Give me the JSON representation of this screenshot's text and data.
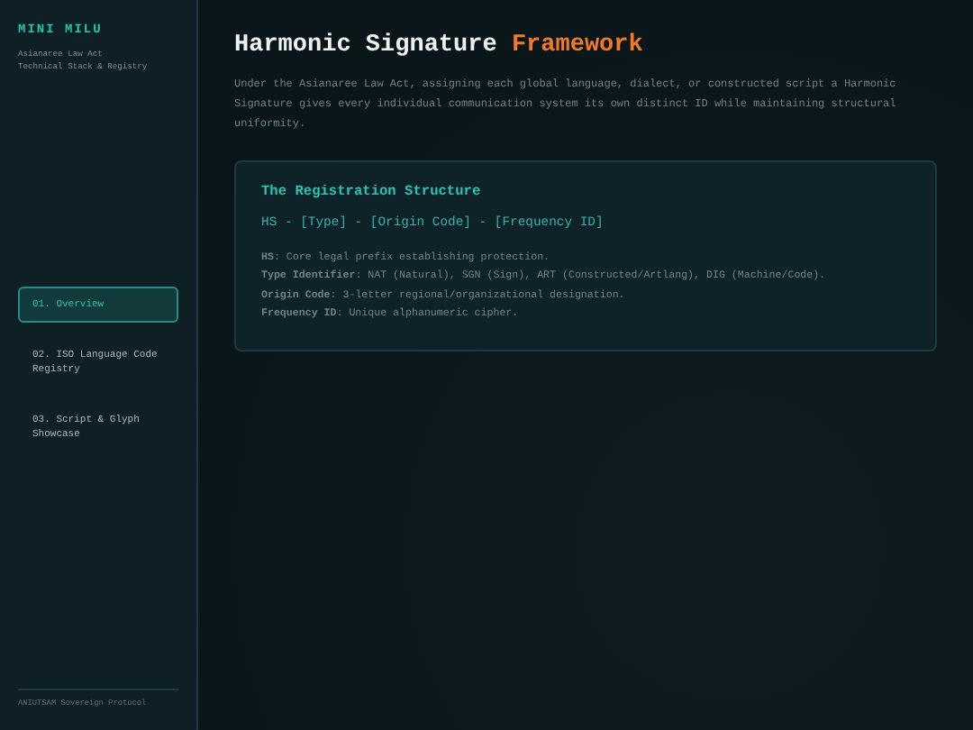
{
  "sidebar": {
    "brand": "MINI MILU",
    "subtitle_lines": [
      "Asianaree Law Act",
      "Technical Stack & Registry"
    ],
    "items": [
      {
        "label": "01. Overview",
        "selected": true
      },
      {
        "label": "02. ISO Language Code Registry",
        "selected": false
      },
      {
        "label": "03. Script & Glyph Showcase",
        "selected": false
      }
    ],
    "footer": "ANIUTSAM Sovereign Protocol"
  },
  "main": {
    "title": "Harmonic Signature",
    "title_accent": "Framework",
    "intro": "Under the Asianaree Law Act, assigning each global language, dialect, or constructed script a Harmonic Signature gives every individual communication system its own distinct ID while maintaining structural uniformity.",
    "card": {
      "heading": "The Registration Structure",
      "formula": "HS - [Type] - [Origin Code] - [Frequency ID]",
      "definitions": [
        "**HS**: Core legal prefix establishing protection.",
        "**Type Identifier**: NAT (Natural), SGN (Sign), ART (Constructed/Artlang), DIG (Machine/Code).",
        "**Origin Code**: 3-letter regional/organizational designation.",
        "**Frequency ID**: Unique alphanumeric cipher."
      ]
    }
  }
}
